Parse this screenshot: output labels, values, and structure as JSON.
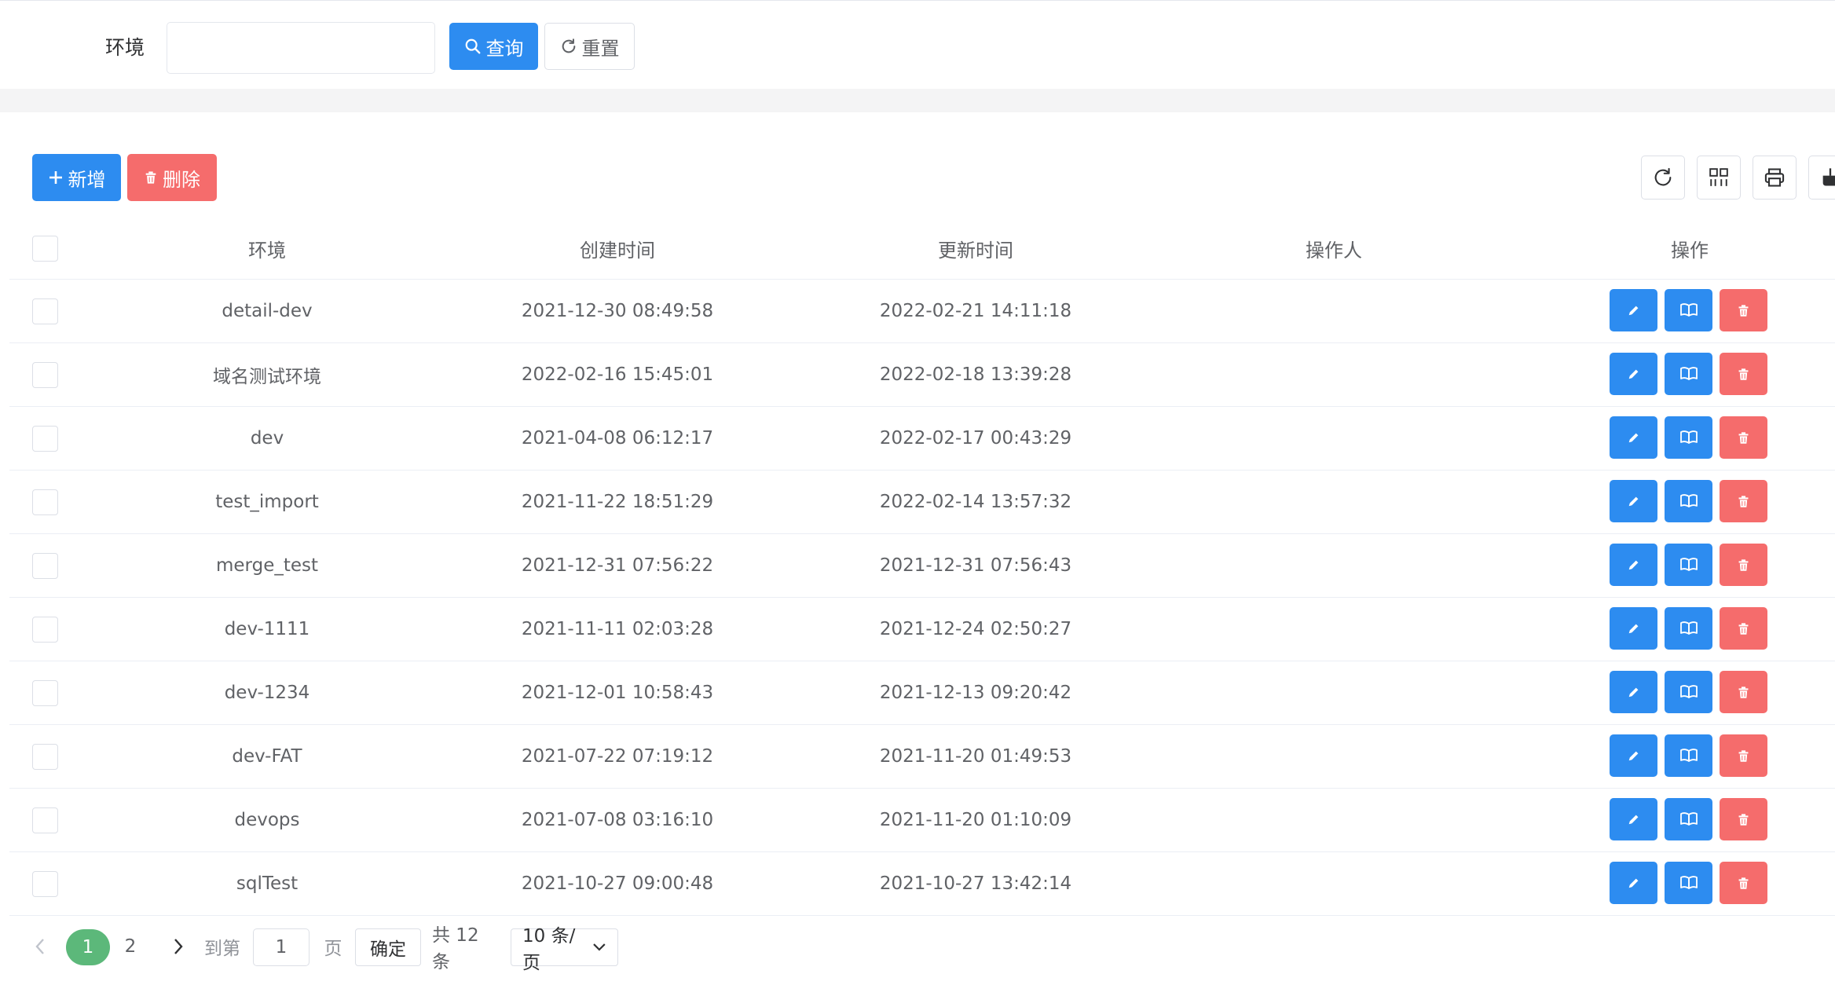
{
  "search": {
    "label": "环境",
    "input_value": "",
    "placeholder": "",
    "query_label": "查询",
    "reset_label": "重置"
  },
  "toolbar": {
    "add_label": "新增",
    "delete_label": "删除",
    "icons": [
      "refresh-icon",
      "columns-icon",
      "print-icon",
      "export-icon"
    ]
  },
  "table": {
    "columns": [
      "环境",
      "创建时间",
      "更新时间",
      "操作人",
      "操作"
    ],
    "rows": [
      {
        "env": "detail-dev",
        "created": "2021-12-30 08:49:58",
        "updated": "2022-02-21 14:11:18",
        "operator": ""
      },
      {
        "env": "域名测试环境",
        "created": "2022-02-16 15:45:01",
        "updated": "2022-02-18 13:39:28",
        "operator": ""
      },
      {
        "env": "dev",
        "created": "2021-04-08 06:12:17",
        "updated": "2022-02-17 00:43:29",
        "operator": ""
      },
      {
        "env": "test_import",
        "created": "2021-11-22 18:51:29",
        "updated": "2022-02-14 13:57:32",
        "operator": ""
      },
      {
        "env": "merge_test",
        "created": "2021-12-31 07:56:22",
        "updated": "2021-12-31 07:56:43",
        "operator": ""
      },
      {
        "env": "dev-1111",
        "created": "2021-11-11 02:03:28",
        "updated": "2021-12-24 02:50:27",
        "operator": ""
      },
      {
        "env": "dev-1234",
        "created": "2021-12-01 10:58:43",
        "updated": "2021-12-13 09:20:42",
        "operator": ""
      },
      {
        "env": "dev-FAT",
        "created": "2021-07-22 07:19:12",
        "updated": "2021-11-20 01:49:53",
        "operator": ""
      },
      {
        "env": "devops",
        "created": "2021-07-08 03:16:10",
        "updated": "2021-11-20 01:10:09",
        "operator": ""
      },
      {
        "env": "sqlTest",
        "created": "2021-10-27 09:00:48",
        "updated": "2021-10-27 13:42:14",
        "operator": ""
      }
    ]
  },
  "pagination": {
    "pages": [
      "1",
      "2"
    ],
    "current_page": "1",
    "goto_label": "到第",
    "goto_value": "1",
    "page_suffix": "页",
    "confirm_label": "确定",
    "total_text": "共 12 条",
    "page_size": "10 条/页"
  },
  "colors": {
    "primary": "#2d8cf0",
    "danger": "#f56c6c",
    "success": "#5cb87a"
  }
}
